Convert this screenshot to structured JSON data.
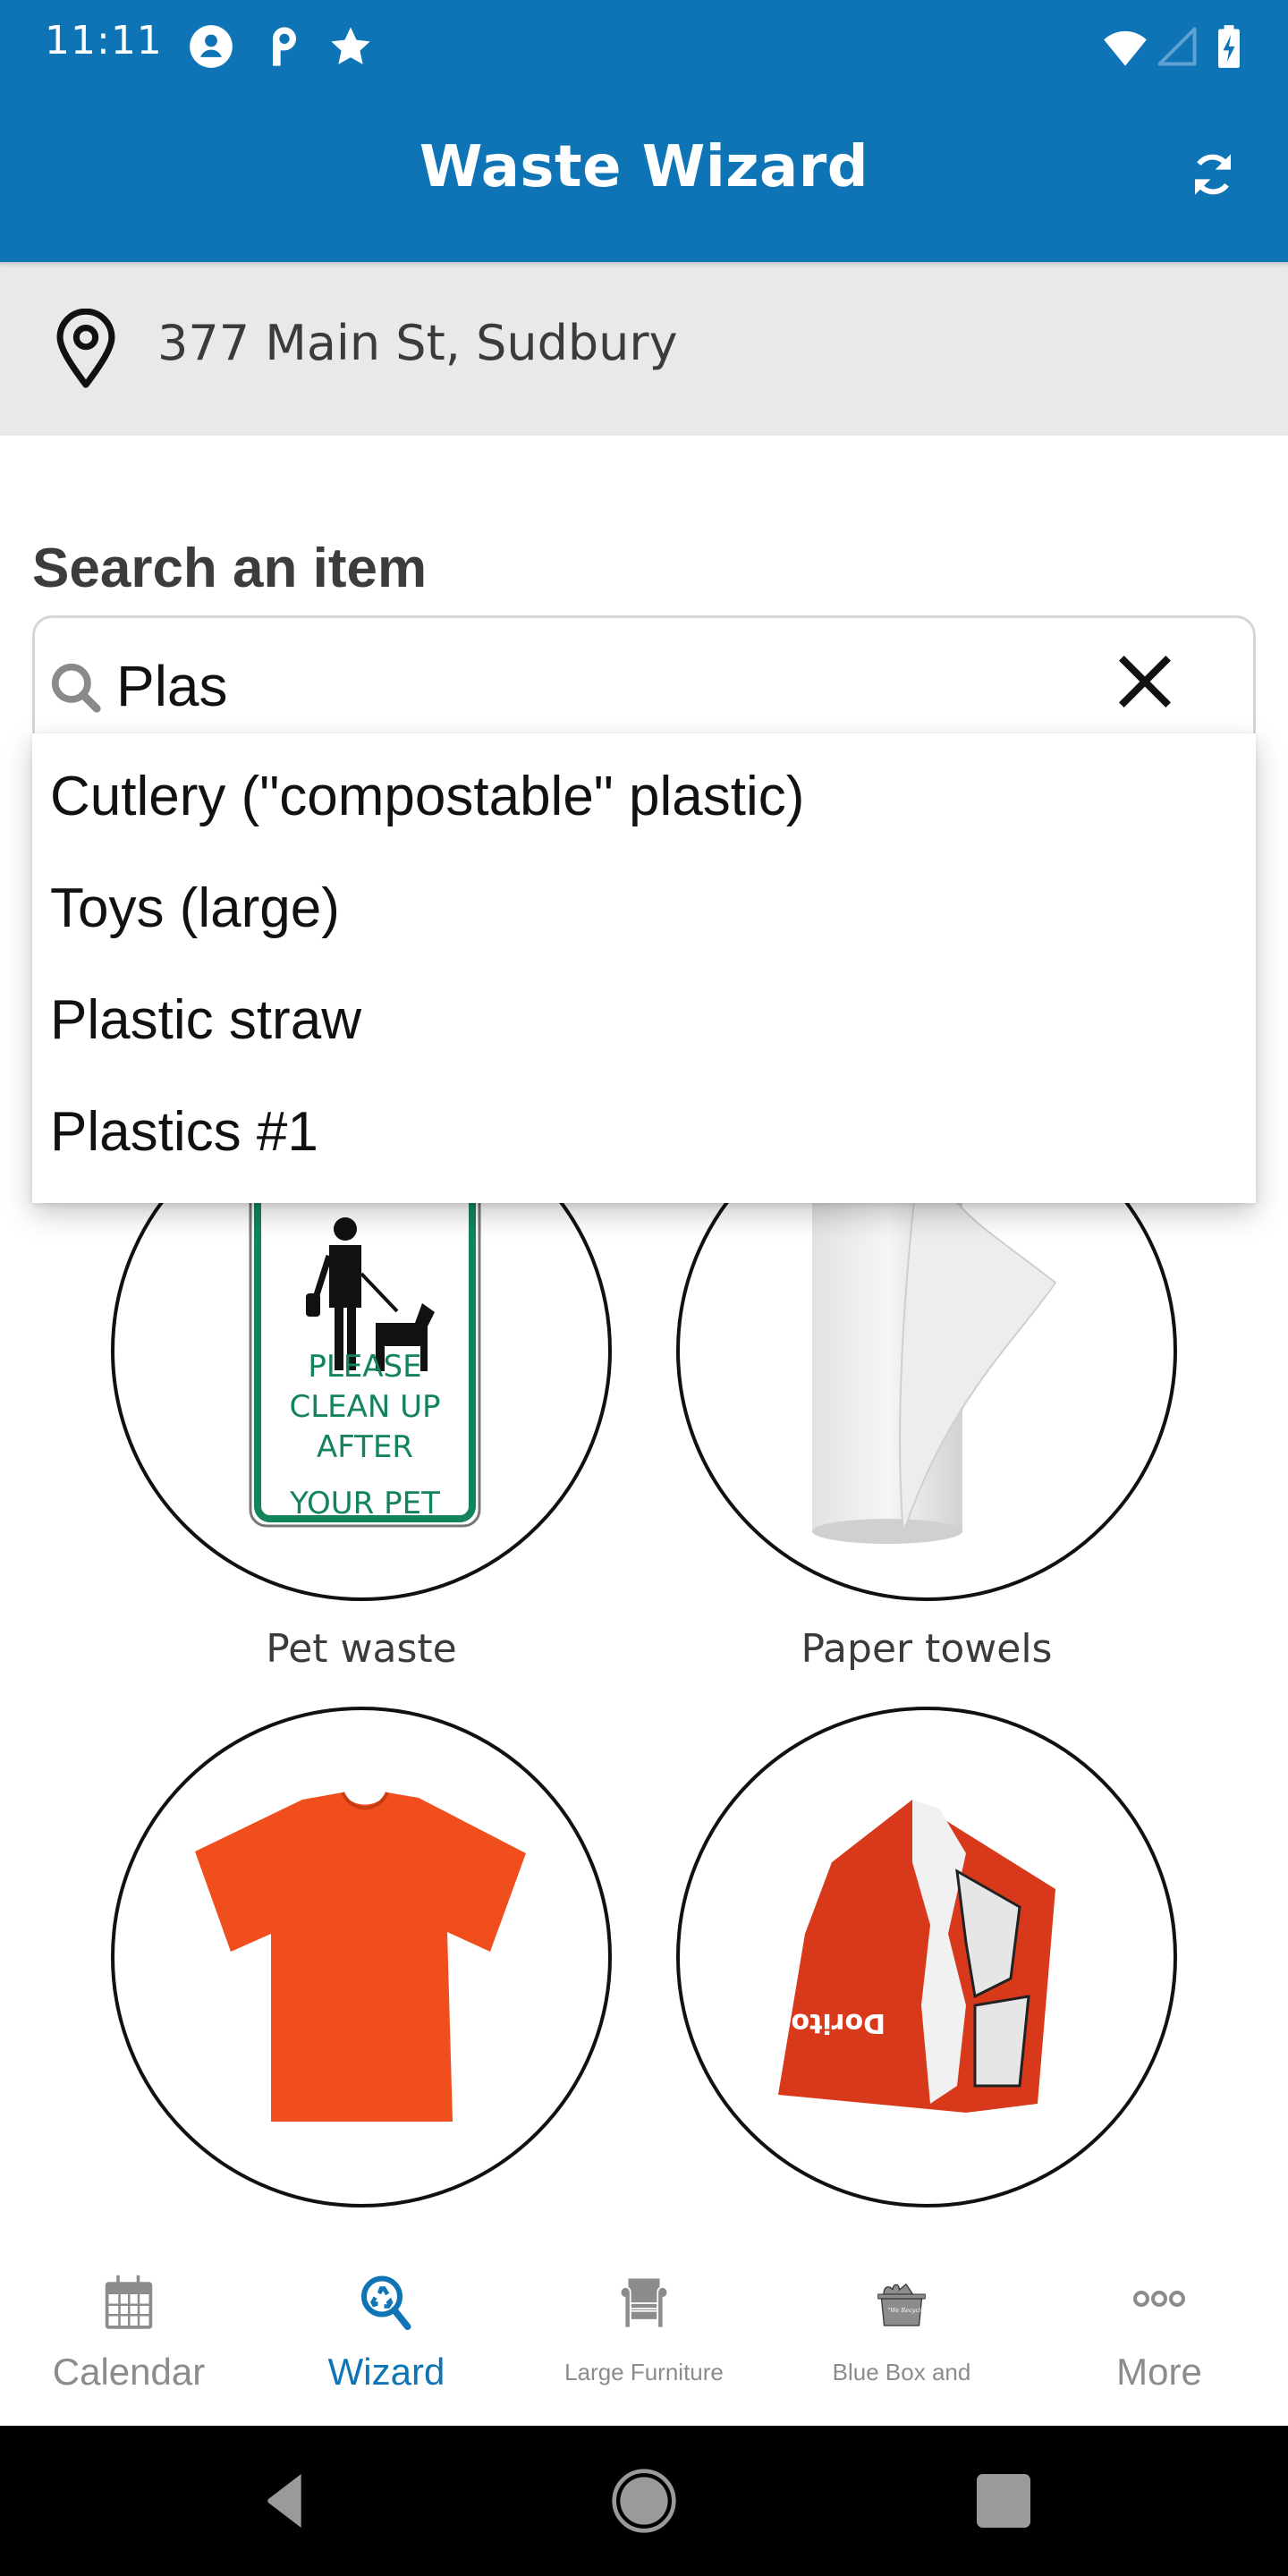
{
  "status_bar": {
    "time": "11:11",
    "left_icons": [
      "account-circle-icon",
      "parking-icon",
      "star-icon"
    ],
    "right_icons": [
      "wifi-icon",
      "cell-signal-empty-icon",
      "battery-charging-icon"
    ]
  },
  "app_bar": {
    "title": "Waste Wizard",
    "action_icon": "refresh-icon"
  },
  "address": {
    "icon": "location-pin-icon",
    "text": "377 Main St, Sudbury"
  },
  "search": {
    "label": "Search an item",
    "value": "Plas",
    "placeholder": "",
    "suggestions": [
      "Cutlery (\"compostable\" plastic)",
      "Toys (large)",
      "Plastic straw",
      "Plastics #1"
    ]
  },
  "items": [
    {
      "label": "Pet waste",
      "image": "pet-waste-sign",
      "sign_text": [
        "PLEASE",
        "CLEAN UP",
        "AFTER",
        "YOUR PET"
      ]
    },
    {
      "label": "Paper towels",
      "image": "paper-towel-roll"
    },
    {
      "label": "",
      "image": "orange-t-shirt"
    },
    {
      "label": "",
      "image": "chip-bag",
      "brand_text": "Doritos"
    }
  ],
  "bottom_nav": {
    "active_index": 1,
    "items": [
      {
        "label": "Calendar",
        "icon": "calendar-icon"
      },
      {
        "label": "Wizard",
        "icon": "recycle-search-icon"
      },
      {
        "label": "Large Furniture",
        "icon": "armchair-icon"
      },
      {
        "label": "Blue Box and",
        "icon": "recycling-bin-icon",
        "icon_text": "\"We Recycle!\""
      },
      {
        "label": "More",
        "icon": "more-dots-icon"
      }
    ]
  },
  "system_nav": [
    "back-icon",
    "home-icon",
    "recents-icon"
  ],
  "colors": {
    "primary": "#0e74b5",
    "address_bg": "#e9e9e9",
    "inactive_nav": "#8c8c8c",
    "sign_green": "#13845a",
    "shirt_orange": "#f04e1c"
  }
}
